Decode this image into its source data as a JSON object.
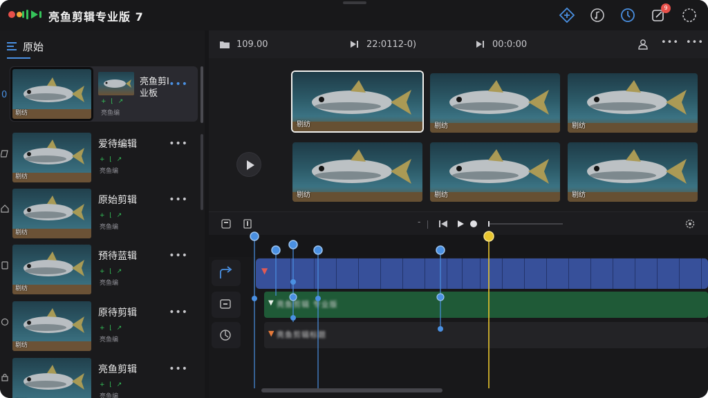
{
  "app": {
    "title": "亮鱼剪辑专业版 7",
    "notification_count": "9",
    "colors": {
      "accent": "#4a90e2",
      "close": "#e8504a",
      "minimize": "#f0a53a",
      "logo_green": "#35c35a",
      "playhead": "#e8c52e"
    }
  },
  "sidebar": {
    "title": "原始",
    "items": [
      {
        "name": "亮鱼剪I 业板",
        "meta": "+ ⌊ ↗",
        "sub": "亮鱼编",
        "thumb_caption": "剔纺",
        "selected": true
      },
      {
        "name": "爱待编辑",
        "meta": "+ ⌊ ↗",
        "sub": "亮鱼编",
        "thumb_caption": "剔纺"
      },
      {
        "name": "原始剪辑",
        "meta": "+ ⌊ ↗",
        "sub": "亮鱼编",
        "thumb_caption": "剔纺"
      },
      {
        "name": "预待蓝辑",
        "meta": "+ ⌊ ↗",
        "sub": "亮鱼编",
        "thumb_caption": "剔纺"
      },
      {
        "name": "原待剪辑",
        "meta": "+ ⌊ ↗",
        "sub": "亮鱼编",
        "thumb_caption": "剔纺"
      },
      {
        "name": "亮鱼剪辑",
        "meta": "+ ⌊ ↗",
        "sub": "亮鱼编",
        "thumb_caption": "剔纺"
      }
    ]
  },
  "viewer": {
    "folder_value": "109.00",
    "timecode_1": "22:0112-0)",
    "timecode_2": "00:0:00",
    "frames": [
      {
        "label": "剔纺",
        "selected": true
      },
      {
        "label": "剔纺"
      },
      {
        "label": "剔纺"
      },
      {
        "label": "剔纺"
      },
      {
        "label": "剔纺"
      },
      {
        "label": "剔纺"
      }
    ]
  },
  "timeline": {
    "audio_track_label": "亮鱼剪辑 专业版",
    "text_track_label": "亮鱼剪辑标题"
  }
}
